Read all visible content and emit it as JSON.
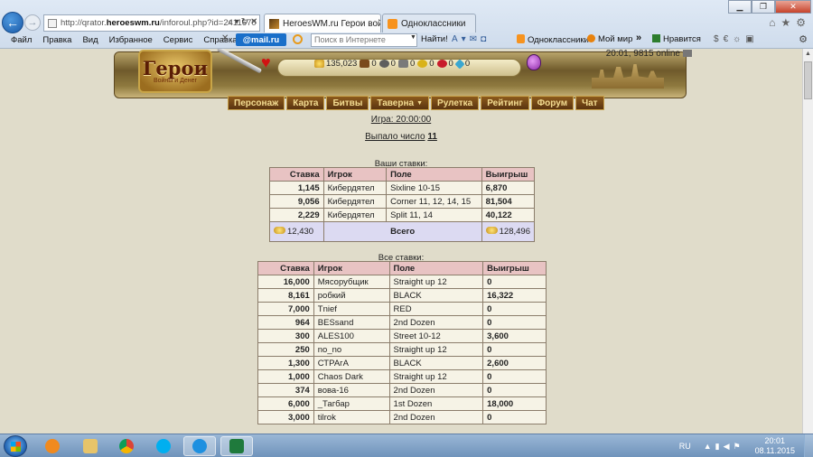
{
  "browser": {
    "url_prefix": "http://qrator.",
    "url_domain": "heroeswm.ru",
    "url_path": "/inforoul.php?id=2411670",
    "tabs": [
      {
        "title": "HeroesWM.ru Герои войн...",
        "close": "✕"
      },
      {
        "title": "Одноклассники"
      }
    ],
    "menu": [
      "Файл",
      "Правка",
      "Вид",
      "Избранное",
      "Сервис",
      "Справка"
    ],
    "toolbar": {
      "mailru": "@mail.ru",
      "search_placeholder": "Поиск в Интернете",
      "find_label": "Найти!",
      "ok_label": "Одноклассники",
      "mm_label": "Мой мир",
      "like_label": "Нравится",
      "more": "»"
    }
  },
  "game": {
    "logo_title": "Герои",
    "logo_subtitle": "Войны и Денег",
    "clock": "20:01, 9815 online",
    "resources": {
      "gold": "135,023",
      "wood": "0",
      "ore": "0",
      "mercury": "0",
      "sulfur": "0",
      "crystals": "0",
      "gems": "0"
    },
    "menu": [
      {
        "label": "Персонаж"
      },
      {
        "label": "Карта"
      },
      {
        "label": "Битвы"
      },
      {
        "label": "Таверна",
        "dropdown": "▼"
      },
      {
        "label": "Рулетка"
      },
      {
        "label": "Рейтинг"
      },
      {
        "label": "Форум"
      },
      {
        "label": "Чат"
      }
    ]
  },
  "content": {
    "game_time": "Игра: 20:00:00",
    "dropped_label": "Выпало число",
    "dropped_number": "11",
    "your_bets_title": "Ваши ставки:",
    "your_bets_headers": [
      "Ставка",
      "Игрок",
      "Поле",
      "Выигрыш"
    ],
    "your_bets": [
      {
        "bet": "1,145",
        "player": "Кибердятел",
        "field": "Sixline 10-15",
        "win": "6,870"
      },
      {
        "bet": "9,056",
        "player": "Кибердятел",
        "field": "Corner 11, 12, 14, 15",
        "win": "81,504"
      },
      {
        "bet": "2,229",
        "player": "Кибердятел",
        "field": "Split 11, 14",
        "win": "40,122"
      }
    ],
    "your_bets_total": {
      "bet": "12,430",
      "label": "Всего",
      "win": "128,496"
    },
    "all_bets_title": "Все ставки:",
    "all_bets_headers": [
      "Ставка",
      "Игрок",
      "Поле",
      "Выигрыш"
    ],
    "all_bets": [
      {
        "bet": "16,000",
        "player": "Мясорубщик",
        "field": "Straight up 12",
        "win": "0"
      },
      {
        "bet": "8,161",
        "player": "робкий",
        "field": "BLACK",
        "win": "16,322"
      },
      {
        "bet": "7,000",
        "player": "Tnief",
        "field": "RED",
        "win": "0"
      },
      {
        "bet": "964",
        "player": "BESsand",
        "field": "2nd Dozen",
        "win": "0"
      },
      {
        "bet": "300",
        "player": "ALES100",
        "field": "Street 10-12",
        "win": "3,600"
      },
      {
        "bet": "250",
        "player": "no_no",
        "field": "Straight up 12",
        "win": "0"
      },
      {
        "bet": "1,300",
        "player": "СТРАгА",
        "field": "BLACK",
        "win": "2,600"
      },
      {
        "bet": "1,000",
        "player": "Chaos Dark",
        "field": "Straight up 12",
        "win": "0"
      },
      {
        "bet": "374",
        "player": "вова-16",
        "field": "2nd Dozen",
        "win": "0"
      },
      {
        "bet": "6,000",
        "player": "_Тагбар",
        "field": "1st Dozen",
        "win": "18,000"
      },
      {
        "bet": "3,000",
        "player": "tilrok",
        "field": "2nd Dozen",
        "win": "0"
      }
    ]
  },
  "taskbar": {
    "lang": "RU",
    "time": "20:01",
    "date": "08.11.2015"
  }
}
